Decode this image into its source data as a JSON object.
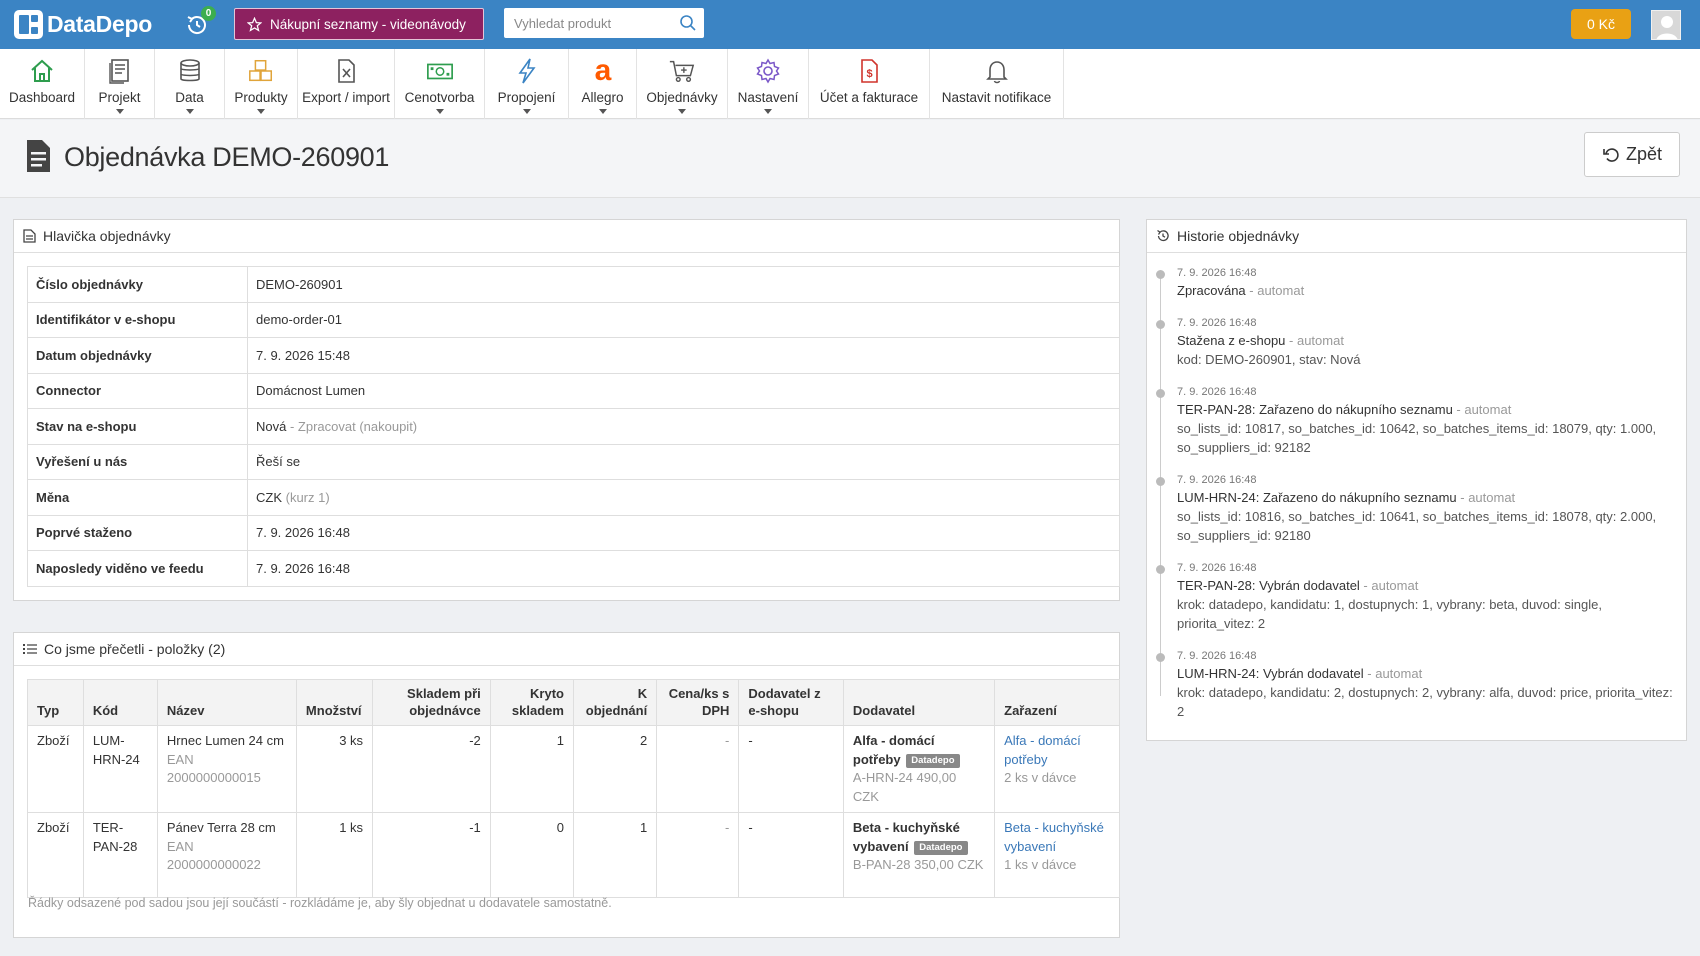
{
  "header": {
    "logo_text": "DataDepo",
    "history_badge": "0",
    "promo_label": "Nákupní seznamy - videonávody",
    "search_placeholder": "Vyhledat produkt",
    "credit": "0 Kč"
  },
  "nav": {
    "items": [
      {
        "label": "Dashboard",
        "icon": "home-icon",
        "color": "#2e9d4e"
      },
      {
        "label": "Projekt",
        "icon": "document-icon",
        "color": "#555555"
      },
      {
        "label": "Data",
        "icon": "database-icon",
        "color": "#555555"
      },
      {
        "label": "Produkty",
        "icon": "boxes-icon",
        "color": "#e0a43a"
      },
      {
        "label": "Export / import",
        "icon": "excel-file-icon",
        "color": "#555555"
      },
      {
        "label": "Cenotvorba",
        "icon": "money-icon",
        "color": "#2e9d4e"
      },
      {
        "label": "Propojení",
        "icon": "lightning-icon",
        "color": "#3b84c4"
      },
      {
        "label": "Allegro",
        "icon": "allegro-icon",
        "color": "#ff5a00"
      },
      {
        "label": "Objednávky",
        "icon": "cart-icon",
        "color": "#555555"
      },
      {
        "label": "Nastavení",
        "icon": "gear-icon",
        "color": "#7a57c8"
      },
      {
        "label": "Účet a fakturace",
        "icon": "invoice-icon",
        "color": "#d0342c"
      },
      {
        "label": "Nastavit notifikace",
        "icon": "bell-icon",
        "color": "#555555"
      }
    ]
  },
  "page": {
    "title": "Objednávka DEMO-260901",
    "back_label": "Zpět"
  },
  "order_header": {
    "title": "Hlavička objednávky",
    "rows": [
      {
        "key": "Číslo objednávky",
        "value": "DEMO-260901",
        "extra": ""
      },
      {
        "key": "Identifikátor v e-shopu",
        "value": "demo-order-01",
        "extra": ""
      },
      {
        "key": "Datum objednávky",
        "value": "7. 9. 2026 15:48",
        "extra": ""
      },
      {
        "key": "Connector",
        "value": "Domácnost Lumen",
        "extra": ""
      },
      {
        "key": "Stav na e-shopu",
        "value": "Nová",
        "extra": " - Zpracovat (nakoupit)"
      },
      {
        "key": "Vyřešení u nás",
        "value": "Řeší se",
        "extra": ""
      },
      {
        "key": "Měna",
        "value": "CZK",
        "extra": " (kurz 1)"
      },
      {
        "key": "Poprvé staženo",
        "value": "7. 9. 2026 16:48",
        "extra": ""
      },
      {
        "key": "Naposledy viděno ve feedu",
        "value": "7. 9. 2026 16:48",
        "extra": ""
      }
    ]
  },
  "items": {
    "title": "Co jsme přečetli - položky (2)",
    "columns": [
      "Typ",
      "Kód",
      "Název",
      "Množství",
      "Skladem při objednávce",
      "Kryto skladem",
      "K objednání",
      "Cena/ks s DPH",
      "Dodavatel z e-shopu",
      "Dodavatel",
      "Zařazení"
    ],
    "rows": [
      {
        "type": "Zboží",
        "code": "LUM-HRN-24",
        "name": "Hrnec Lumen 24 cm",
        "ean": "EAN 2000000000015",
        "qty": "3 ks",
        "stock": "-2",
        "covered": "1",
        "to_order": "2",
        "price": "-",
        "eshop_supplier": "-",
        "supplier": "Alfa - domácí potřeby",
        "badge": "Datadepo",
        "supplier_detail": "A-HRN-24 490,00 CZK",
        "assign_link": "Alfa - domácí potřeby",
        "assign_note": "2 ks v dávce"
      },
      {
        "type": "Zboží",
        "code": "TER-PAN-28",
        "name": "Pánev Terra 28 cm",
        "ean": "EAN 2000000000022",
        "qty": "1 ks",
        "stock": "-1",
        "covered": "0",
        "to_order": "1",
        "price": "-",
        "eshop_supplier": "-",
        "supplier": "Beta - kuchyňské vybavení",
        "badge": "Datadepo",
        "supplier_detail": "B-PAN-28 350,00 CZK",
        "assign_link": "Beta - kuchyňské vybavení",
        "assign_note": "1 ks v dávce"
      }
    ],
    "note": "Řádky odsazené pod sadou jsou její součástí - rozkládáme je, aby šly objednat u dodavatele samostatně."
  },
  "history": {
    "title": "Historie objednávky",
    "entries": [
      {
        "date": "7. 9. 2026 16:48",
        "title": "Zpracována",
        "auto": " - automat",
        "detail": ""
      },
      {
        "date": "7. 9. 2026 16:48",
        "title": "Stažena z e-shopu",
        "auto": " - automat",
        "detail": "kod: DEMO-260901, stav: Nová"
      },
      {
        "date": "7. 9. 2026 16:48",
        "title": "TER-PAN-28: Zařazeno do nákupního seznamu",
        "auto": " - automat",
        "detail": "so_lists_id: 10817, so_batches_id: 10642, so_batches_items_id: 18079, qty: 1.000, so_suppliers_id: 92182"
      },
      {
        "date": "7. 9. 2026 16:48",
        "title": "LUM-HRN-24: Zařazeno do nákupního seznamu",
        "auto": " - automat",
        "detail": "so_lists_id: 10816, so_batches_id: 10641, so_batches_items_id: 18078, qty: 2.000, so_suppliers_id: 92180"
      },
      {
        "date": "7. 9. 2026 16:48",
        "title": "TER-PAN-28: Vybrán dodavatel",
        "auto": " - automat",
        "detail": "krok: datadepo, kandidatu: 1, dostupnych: 1, vybrany: beta, duvod: single, priorita_vitez: 2"
      },
      {
        "date": "7. 9. 2026 16:48",
        "title": "LUM-HRN-24: Vybrán dodavatel",
        "auto": " - automat",
        "detail": "krok: datadepo, kandidatu: 2, dostupnych: 2, vybrany: alfa, duvod: price, priorita_vitez: 2"
      }
    ]
  },
  "colors": {
    "topbar": "#3b84c4",
    "promo": "#8d2160",
    "credit": "#e9a114",
    "badge": "#3cae4e"
  }
}
